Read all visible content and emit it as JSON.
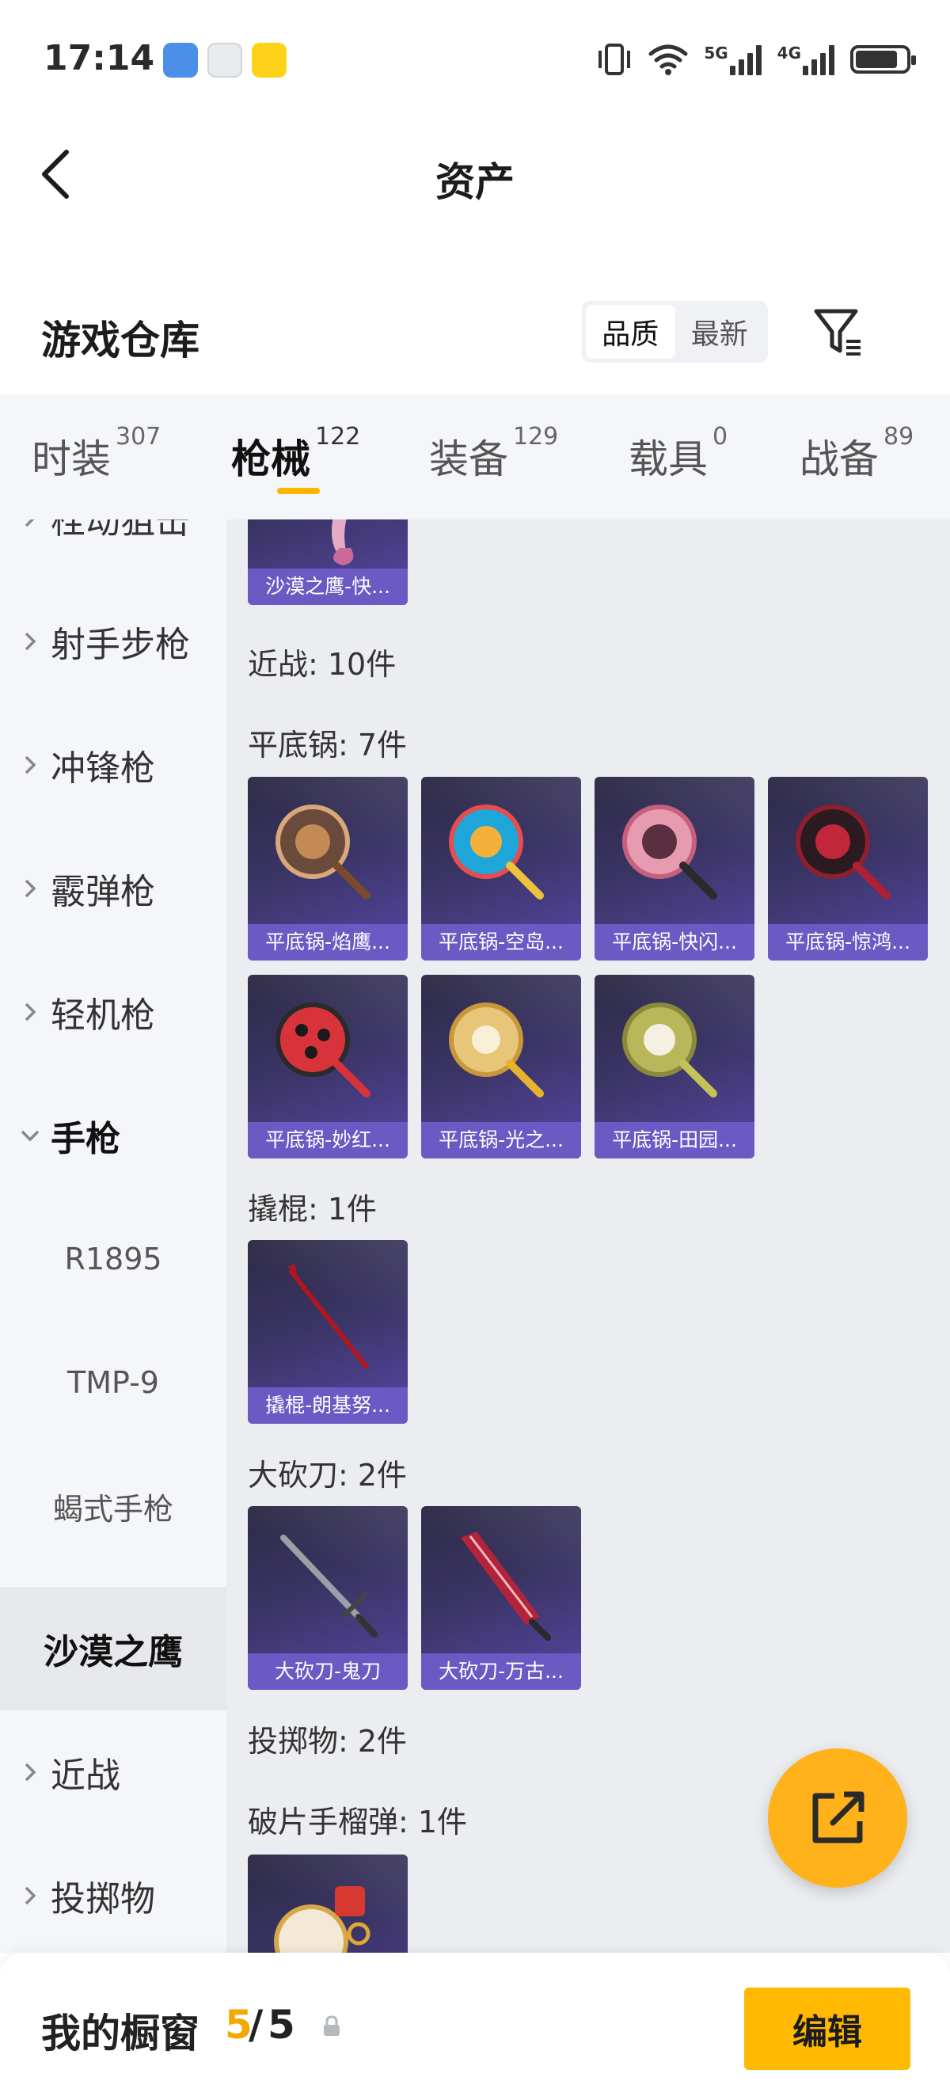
{
  "status_bar": {
    "time": "17:14",
    "network_5g": "5G",
    "network_4g": "4G"
  },
  "header": {
    "title": "资产"
  },
  "section": {
    "title": "游戏仓库",
    "sort_options": [
      "品质",
      "最新"
    ],
    "sort_active": "品质"
  },
  "tabs": [
    {
      "label": "时装",
      "count": "307"
    },
    {
      "label": "枪械",
      "count": "122",
      "active": true
    },
    {
      "label": "装备",
      "count": "129"
    },
    {
      "label": "载具",
      "count": "0"
    },
    {
      "label": "战备",
      "count": "89"
    }
  ],
  "sidebar": {
    "items": [
      {
        "label": "栓动狙击"
      },
      {
        "label": "射手步枪"
      },
      {
        "label": "冲锋枪"
      },
      {
        "label": "霰弹枪"
      },
      {
        "label": "轻机枪"
      },
      {
        "label": "手枪"
      },
      {
        "label": "R1895"
      },
      {
        "label": "TMP-9"
      },
      {
        "label": "蝎式手枪"
      },
      {
        "label": "沙漠之鹰"
      },
      {
        "label": "近战"
      },
      {
        "label": "投掷物"
      }
    ]
  },
  "content": {
    "top_card": {
      "label": "沙漠之鹰-快..."
    },
    "groups": {
      "melee": "近战: 10件",
      "pan": "平底锅: 7件",
      "crowbar": "撬棍: 1件",
      "machete": "大砍刀: 2件",
      "throwable": "投掷物: 2件",
      "grenade": "破片手榴弹: 1件"
    },
    "pans": [
      "平底锅-焰鹰...",
      "平底锅-空岛...",
      "平底锅-快闪...",
      "平底锅-惊鸿...",
      "平底锅-妙红...",
      "平底锅-光之...",
      "平底锅-田园..."
    ],
    "crowbars": [
      "撬棍-朗基努..."
    ],
    "machetes": [
      "大砍刀-鬼刀",
      "大砍刀-万古..."
    ]
  },
  "bottom_bar": {
    "label": "我的橱窗",
    "current": "5",
    "separator": "/",
    "max": "5",
    "edit_label": "编辑"
  },
  "colors": {
    "accent": "#ffb400",
    "card_label": "#6b5ac4",
    "sidebar_bg": "#f4f6f9",
    "content_bg": "#ebedf0"
  },
  "icons": {
    "back": "chevron-left-icon",
    "filter": "filter-icon",
    "share": "share-icon",
    "lock": "lock-icon"
  }
}
